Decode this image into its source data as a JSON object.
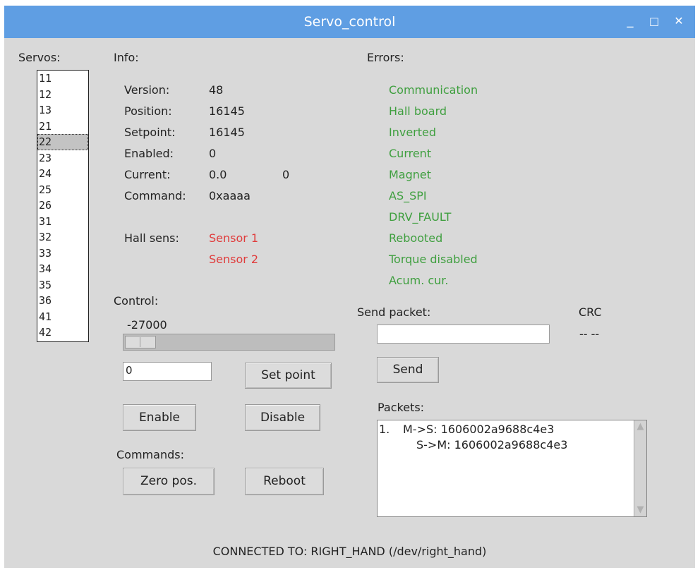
{
  "window": {
    "title": "Servo_control"
  },
  "titlebar": {
    "minimize": "_",
    "maximize": "□",
    "close": "✕"
  },
  "servos": {
    "label": "Servos:",
    "items": [
      "11",
      "12",
      "13",
      "21",
      "22",
      "23",
      "24",
      "25",
      "26",
      "31",
      "32",
      "33",
      "34",
      "35",
      "36",
      "41",
      "42"
    ],
    "selected": "22"
  },
  "info": {
    "label": "Info:",
    "rows": [
      {
        "key": "Version:",
        "value": "48"
      },
      {
        "key": "Position:",
        "value": "16145"
      },
      {
        "key": "Setpoint:",
        "value": "16145"
      },
      {
        "key": "Enabled:",
        "value": "0"
      },
      {
        "key": "Current:",
        "value": "0.0",
        "extra": "0"
      },
      {
        "key": "Command:",
        "value": "0xaaaa"
      }
    ],
    "hall_label": "Hall sens:",
    "hall_sensors": [
      "Sensor 1",
      "Sensor 2"
    ]
  },
  "errors": {
    "label": "Errors:",
    "items": [
      "Communication",
      "Hall board",
      "Inverted",
      "Current",
      "Magnet",
      "AS_SPI",
      "DRV_FAULT",
      "Rebooted",
      "Torque disabled",
      "Acum. cur."
    ]
  },
  "control": {
    "label": "Control:",
    "scale_value": "-27000",
    "setpoint_input": "0",
    "set_point_button": "Set point",
    "enable_button": "Enable",
    "disable_button": "Disable"
  },
  "commands": {
    "label": "Commands:",
    "zero_button": "Zero pos.",
    "reboot_button": "Reboot"
  },
  "send": {
    "label": "Send packet:",
    "crc_label": "CRC",
    "crc_value": "-- --",
    "input_value": "",
    "send_button": "Send"
  },
  "packets": {
    "label": "Packets:",
    "lines": [
      {
        "num": "1.",
        "text": "M->S: 1606002a9688c4e3"
      },
      {
        "num": "",
        "text": "S->M: 1606002a9688c4e3"
      }
    ]
  },
  "status": {
    "text": "CONNECTED TO: RIGHT_HAND (/dev/right_hand)"
  }
}
